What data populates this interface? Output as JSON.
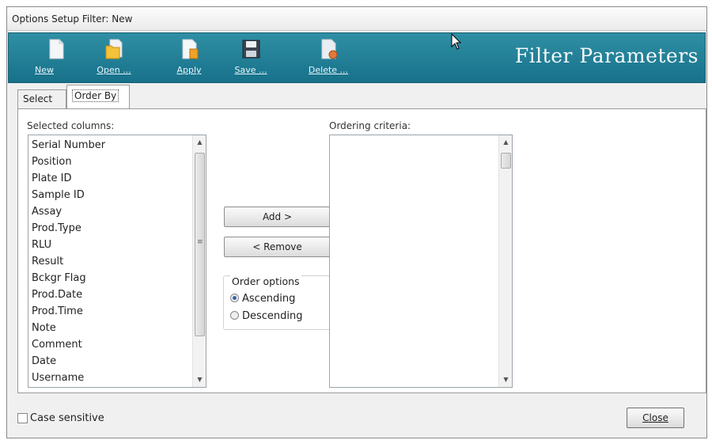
{
  "window": {
    "title": "Options Setup Filter: New"
  },
  "toolbar": {
    "buttons": [
      {
        "label": "New",
        "icon": "new-document-icon"
      },
      {
        "label": "Open ...",
        "icon": "open-folder-icon"
      },
      {
        "label": "Apply",
        "icon": "apply-document-icon"
      },
      {
        "label": "Save ...",
        "icon": "floppy-disk-icon"
      },
      {
        "label": "Delete ...",
        "icon": "delete-document-icon"
      }
    ],
    "title": "Filter Parameters",
    "background": "#1f7d94"
  },
  "tabs": [
    {
      "label": "Select",
      "active": false
    },
    {
      "label": "Order By",
      "active": true
    }
  ],
  "panel": {
    "selected_columns_label": "Selected columns:",
    "selected_columns": [
      "Serial Number",
      "Position",
      "Plate ID",
      "Sample ID",
      "Assay",
      "Prod.Type",
      "RLU",
      "Result",
      "Bckgr Flag",
      "Prod.Date",
      "Prod.Time",
      "Note",
      "Comment",
      "Date",
      "Username"
    ],
    "ordering_criteria_label": "Ordering criteria:",
    "ordering_criteria": [],
    "add_label": "Add >",
    "remove_label": "< Remove",
    "order_options": {
      "title": "Order options",
      "options": [
        {
          "label": "Ascending",
          "selected": true
        },
        {
          "label": "Descending",
          "selected": false
        }
      ]
    }
  },
  "footer": {
    "case_sensitive_label": "Case sensitive",
    "case_sensitive_checked": false,
    "close_label": "Close"
  }
}
